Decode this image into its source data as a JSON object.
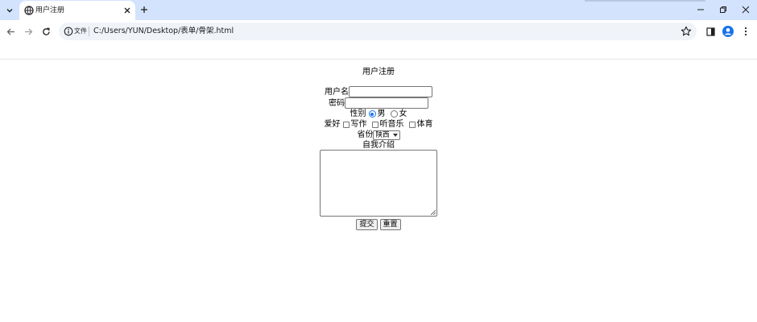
{
  "browser": {
    "tab": {
      "title": "用户注册"
    },
    "address": {
      "scheme_label": "文件",
      "url": "C:/Users/YUN/Desktop/表单/骨架.html"
    },
    "icons": [
      "tab-search-icon",
      "globe-icon",
      "close-icon",
      "plus-icon",
      "minimize-icon",
      "restore-icon",
      "close-window-icon",
      "back-arrow-icon",
      "forward-arrow-icon",
      "reload-icon",
      "info-icon",
      "star-icon",
      "side-panel-icon",
      "profile-icon",
      "kebab-menu-icon"
    ]
  },
  "form": {
    "title": "用户注册",
    "username_label": "用户名",
    "username_value": "",
    "password_label": "密码",
    "password_value": "",
    "gender_label": "性别",
    "gender_options": [
      "男",
      "女"
    ],
    "gender_selected": "男",
    "hobby_label": "爱好",
    "hobby_options": [
      "写作",
      "听音乐",
      "体育"
    ],
    "province_label": "省份",
    "province_selected": "陕西",
    "intro_label": "自我介绍",
    "intro_value": "",
    "submit_label": "提交",
    "reset_label": "重置"
  },
  "colors": {
    "tabstrip": "#d3e3fd",
    "omnibox": "#f0f3f8",
    "accent": "#1a73e8"
  }
}
